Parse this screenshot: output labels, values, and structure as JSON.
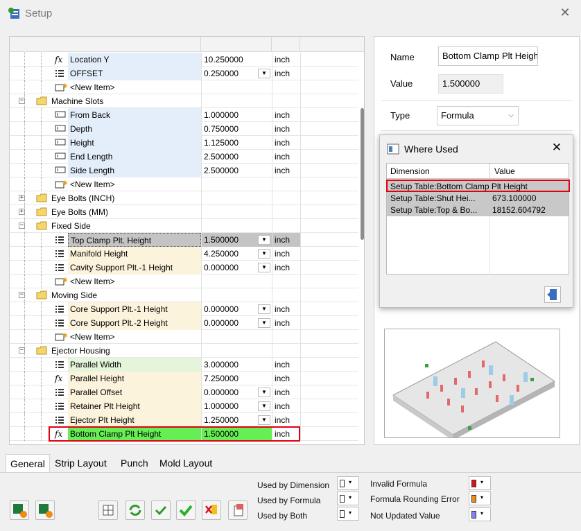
{
  "window": {
    "title": "Setup",
    "close_glyph": "✕"
  },
  "tree": {
    "rows": [
      {
        "indent": 2,
        "icon": "fx-icon",
        "name": "Location Y",
        "value": "10.250000",
        "unit": "inch",
        "bg": "blue",
        "dropdown": false
      },
      {
        "indent": 2,
        "icon": "list-icon",
        "name": "OFFSET",
        "value": "0.250000",
        "unit": "inch",
        "bg": "blue",
        "dropdown": true
      },
      {
        "indent": 2,
        "icon": "new-item-icon",
        "name": "<New Item>",
        "value": "",
        "unit": "",
        "bg": "none",
        "dropdown": false
      },
      {
        "indent": 1,
        "icon": "folder-icon",
        "name": "Machine Slots",
        "value": "",
        "unit": "",
        "bg": "none",
        "expander": "−"
      },
      {
        "indent": 2,
        "icon": "field-icon",
        "name": "From Back",
        "value": "1.000000",
        "unit": "inch",
        "bg": "blue",
        "dropdown": false
      },
      {
        "indent": 2,
        "icon": "field-icon",
        "name": "Depth",
        "value": "0.750000",
        "unit": "inch",
        "bg": "blue",
        "dropdown": false
      },
      {
        "indent": 2,
        "icon": "field-icon",
        "name": "Height",
        "value": "1.125000",
        "unit": "inch",
        "bg": "blue",
        "dropdown": false
      },
      {
        "indent": 2,
        "icon": "field-icon",
        "name": "End Length",
        "value": "2.500000",
        "unit": "inch",
        "bg": "blue",
        "dropdown": false
      },
      {
        "indent": 2,
        "icon": "field-icon",
        "name": "Side Length",
        "value": "2.500000",
        "unit": "inch",
        "bg": "blue",
        "dropdown": false
      },
      {
        "indent": 2,
        "icon": "new-item-icon",
        "name": "<New Item>",
        "value": "",
        "unit": "",
        "bg": "none"
      },
      {
        "indent": 1,
        "icon": "folder-icon",
        "name": "Eye Bolts (INCH)",
        "value": "",
        "unit": "",
        "bg": "none",
        "expander": "+"
      },
      {
        "indent": 1,
        "icon": "folder-icon",
        "name": "Eye Bolts (MM)",
        "value": "",
        "unit": "",
        "bg": "none",
        "expander": "+"
      },
      {
        "indent": 1,
        "icon": "folder-icon",
        "name": "Fixed Side",
        "value": "",
        "unit": "",
        "bg": "none",
        "expander": "−"
      },
      {
        "indent": 2,
        "icon": "list-icon",
        "name": "Top Clamp Plt. Height",
        "value": "1.500000",
        "unit": "inch",
        "bg": "sel",
        "dropdown": true
      },
      {
        "indent": 2,
        "icon": "list-icon",
        "name": "Manifold Height",
        "value": "4.250000",
        "unit": "inch",
        "bg": "cream",
        "dropdown": true
      },
      {
        "indent": 2,
        "icon": "list-icon",
        "name": "Cavity Support Plt.-1  Height",
        "value": "0.000000",
        "unit": "inch",
        "bg": "cream",
        "dropdown": true
      },
      {
        "indent": 2,
        "icon": "new-item-icon",
        "name": "<New Item>",
        "value": "",
        "unit": "",
        "bg": "none"
      },
      {
        "indent": 1,
        "icon": "folder-icon",
        "name": "Moving Side",
        "value": "",
        "unit": "",
        "bg": "none",
        "expander": "−"
      },
      {
        "indent": 2,
        "icon": "list-icon",
        "name": "Core Support Plt.-1  Height",
        "value": "0.000000",
        "unit": "inch",
        "bg": "cream",
        "dropdown": true
      },
      {
        "indent": 2,
        "icon": "list-icon",
        "name": "Core Support Plt.-2  Height",
        "value": "0.000000",
        "unit": "inch",
        "bg": "cream",
        "dropdown": true
      },
      {
        "indent": 2,
        "icon": "new-item-icon",
        "name": "<New Item>",
        "value": "",
        "unit": "",
        "bg": "none"
      },
      {
        "indent": 1,
        "icon": "folder-icon",
        "name": "Ejector Housing",
        "value": "",
        "unit": "",
        "bg": "none",
        "expander": "−"
      },
      {
        "indent": 2,
        "icon": "list-icon",
        "name": "Parallel Width",
        "value": "3.000000",
        "unit": "inch",
        "bg": "green",
        "dropdown": false
      },
      {
        "indent": 2,
        "icon": "fx-icon",
        "name": "Parallel Height",
        "value": "7.250000",
        "unit": "inch",
        "bg": "cream",
        "dropdown": false
      },
      {
        "indent": 2,
        "icon": "list-icon",
        "name": "Parallel Offset",
        "value": "0.000000",
        "unit": "inch",
        "bg": "cream",
        "dropdown": true
      },
      {
        "indent": 2,
        "icon": "list-icon",
        "name": "Retainer Plt Height",
        "value": "1.000000",
        "unit": "inch",
        "bg": "cream",
        "dropdown": true
      },
      {
        "indent": 2,
        "icon": "list-icon",
        "name": "Ejector Plt Height",
        "value": "1.250000",
        "unit": "inch",
        "bg": "cream",
        "dropdown": true
      },
      {
        "indent": 2,
        "icon": "fx-icon",
        "name": "Bottom Clamp Plt Height",
        "value": "1.500000",
        "unit": "inch",
        "bg": "hl",
        "dropdown": false
      }
    ]
  },
  "tabs": [
    "General",
    "Strip Layout",
    "Punch",
    "Mold Layout"
  ],
  "properties": {
    "name_label": "Name",
    "name_value": "Bottom Clamp Plt Height",
    "value_label": "Value",
    "value_value": "1.500000",
    "type_label": "Type",
    "type_value": "Formula"
  },
  "where_used": {
    "title": "Where Used",
    "col_dimension": "Dimension",
    "col_value": "Value",
    "rows": [
      {
        "dimension": "Setup Table:Bottom Clamp Plt Height",
        "value": ""
      },
      {
        "dimension": "Setup Table:Shut Hei...",
        "value": "673.100000"
      },
      {
        "dimension": "Setup Table:Top & Bo...",
        "value": "18152.604792"
      }
    ]
  },
  "legend": {
    "used_by_dimension": "Used by Dimension",
    "used_by_formula": "Used by Formula",
    "used_by_both": "Used by Both",
    "invalid_formula": "Invalid Formula",
    "formula_rounding_error": "Formula Rounding Error",
    "not_updated_value": "Not Updated Value",
    "colors": {
      "invalid": "#e0101a",
      "rounding": "#f08a10",
      "not_updated": "#8080f0"
    }
  },
  "toolbar_icons": [
    "excel-export-1-icon",
    "excel-export-2-icon",
    "layout-icon",
    "refresh-icon",
    "check-back-icon",
    "check-icon",
    "delete-icon",
    "clipboard-icon"
  ]
}
